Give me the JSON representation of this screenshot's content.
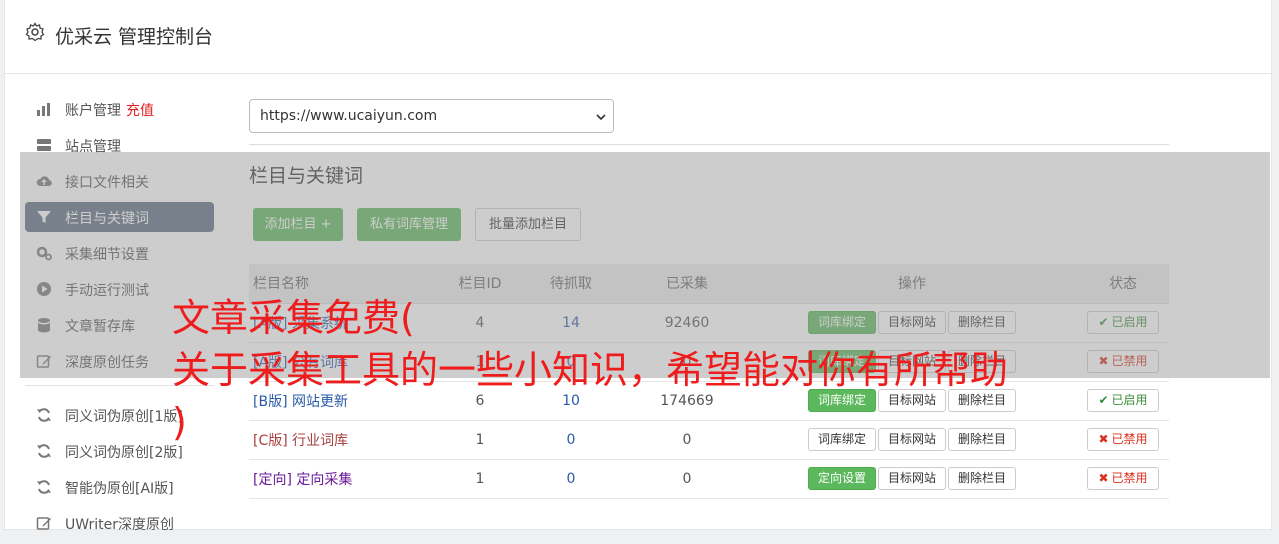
{
  "header": {
    "title": "优采云 管理控制台",
    "icon": "gear-icon"
  },
  "sidebar": {
    "items": [
      {
        "label": "账户管理",
        "extra": "充值",
        "icon": "bar-chart-icon"
      },
      {
        "label": "站点管理",
        "icon": "server-icon"
      },
      {
        "label": "接口文件相关",
        "icon": "cloud-upload-icon"
      },
      {
        "label": "栏目与关键词",
        "icon": "filter-icon",
        "active": true
      },
      {
        "label": "采集细节设置",
        "icon": "cogs-icon"
      },
      {
        "label": "手动运行测试",
        "icon": "play-circle-icon"
      },
      {
        "label": "文章暂存库",
        "icon": "database-icon"
      },
      {
        "label": "深度原创任务",
        "icon": "edit-icon"
      }
    ],
    "items2": [
      {
        "label": "同义词伪原创[1版]",
        "icon": "refresh-icon"
      },
      {
        "label": "同义词伪原创[2版]",
        "icon": "refresh-icon"
      },
      {
        "label": "智能伪原创[AI版]",
        "icon": "refresh-icon"
      },
      {
        "label": "UWriter深度原创",
        "icon": "edit-icon"
      }
    ]
  },
  "site_select": {
    "value": "https://www.ucaiyun.com"
  },
  "section": {
    "title": "栏目与关键词"
  },
  "buttons": {
    "add": "添加栏目 +",
    "private_lib": "私有词库管理",
    "batch_add": "批量添加栏目"
  },
  "table": {
    "headers": [
      "栏目名称",
      "栏目ID",
      "待抓取",
      "已采集",
      "操作",
      "状态"
    ],
    "rows": [
      {
        "tag": "[A版]",
        "name": "采集系统",
        "id": "4",
        "wait": "14",
        "done": "92460",
        "op1": "词库绑定",
        "op1_green": true,
        "op2": "目标网站",
        "op3": "删除栏目",
        "status": "已启用",
        "on": true
      },
      {
        "tag": "[A版]",
        "name": "公有词库",
        "id": "1",
        "wait": "0",
        "done": "0",
        "op1": "词库绑定",
        "op1_green": true,
        "op2": "目标网站",
        "op3": "删除栏目",
        "status": "已禁用",
        "on": false
      },
      {
        "tag": "[B版]",
        "name": "网站更新",
        "id": "6",
        "wait": "10",
        "done": "174669",
        "op1": "词库绑定",
        "op1_green": true,
        "op2": "目标网站",
        "op3": "删除栏目",
        "status": "已启用",
        "on": true
      },
      {
        "tag": "[C版]",
        "name": "行业词库",
        "id": "1",
        "wait": "0",
        "done": "0",
        "op1": "词库绑定",
        "op1_green": false,
        "op2": "目标网站",
        "op3": "删除栏目",
        "status": "已禁用",
        "on": false
      },
      {
        "tag": "[定向]",
        "name": "定向采集",
        "id": "1",
        "wait": "0",
        "done": "0",
        "op1": "定向设置",
        "op1_green": true,
        "op2": "目标网站",
        "op3": "删除栏目",
        "status": "已禁用",
        "on": false
      }
    ]
  },
  "watermark": {
    "line1": "文章采集免费(",
    "line2": "关于采集工具的一些小知识，希望能对你有所帮助",
    "line3": ")"
  },
  "colors": {
    "active_nav": "#5d6e80",
    "green": "#5cb85c",
    "watermark": "#ee1c1c"
  }
}
